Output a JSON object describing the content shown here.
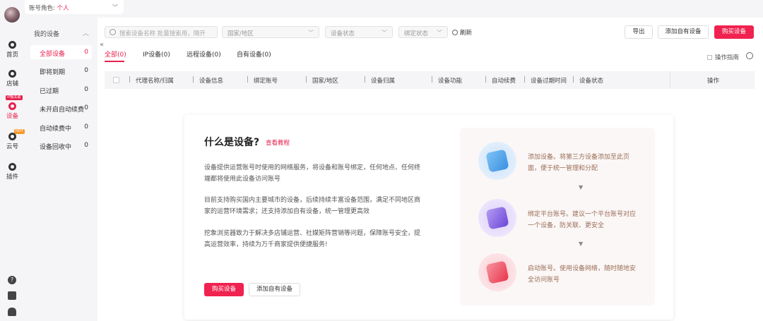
{
  "account": {
    "label": "账号角色: ",
    "value": "个人"
  },
  "rail": {
    "items": [
      {
        "label": "首页"
      },
      {
        "label": "店铺"
      },
      {
        "label": "设备",
        "tag": "IP额关联"
      },
      {
        "label": "云号",
        "tag": "HOT"
      },
      {
        "label": "插件"
      }
    ]
  },
  "sidebar": {
    "header": "我的设备",
    "items": [
      {
        "label": "全部设备",
        "count": "0"
      },
      {
        "label": "即将到期",
        "count": "0"
      },
      {
        "label": "已过期",
        "count": "0"
      },
      {
        "label": "未开启自动续费",
        "count": "0"
      },
      {
        "label": "自动续费中",
        "count": "0"
      },
      {
        "label": "设备回收中",
        "count": "0"
      }
    ]
  },
  "toolbar": {
    "search_placeholder": "搜索设备名称  批量搜索用，隔开",
    "filters": [
      "国家/地区",
      "设备状态",
      "绑定状态"
    ],
    "refresh": "刷新",
    "export": "导出",
    "add_own": "添加自有设备",
    "buy": "购买设备"
  },
  "tabs": [
    "全部(0)",
    "IP设备(0)",
    "远程设备(0)",
    "自有设备(0)"
  ],
  "guide": "操作指南",
  "table": {
    "columns": [
      "代理名称/归属",
      "设备信息",
      "绑定账号",
      "国家/地区",
      "设备归属",
      "设备功能",
      "自动续费",
      "设备过期时间",
      "设备状态",
      "操作"
    ]
  },
  "card": {
    "title": "什么是设备?",
    "link": "查看教程",
    "paragraphs": [
      "设备提供运营账号时使用的网络服务，将设备和账号绑定，任何地点、任何终端都将使用此设备访问账号",
      "目前支持购买国内主要城市的设备，后续持续丰富设备范围，满足不同地区商家的运营环境需求；还支持添加自有设备，统一管理更高效",
      "挖象浏览器致力于解决多店铺运营、社媒矩阵营销等问题，保障账号安全，提高运营效率，持续为万千商家提供便捷服务!"
    ],
    "buy_button": "购买设备",
    "add_button": "添加自有设备",
    "steps": [
      "添加设备。将第三方设备添加至此页面，便于统一管理和分配",
      "绑定平台账号。建议一个平台账号对应一个设备，防关联、更安全",
      "启动账号。使用设备网络，随时随地安全访问账号"
    ]
  },
  "colors": {
    "accent": "#f0224f",
    "step_text": "#9a6e58"
  }
}
